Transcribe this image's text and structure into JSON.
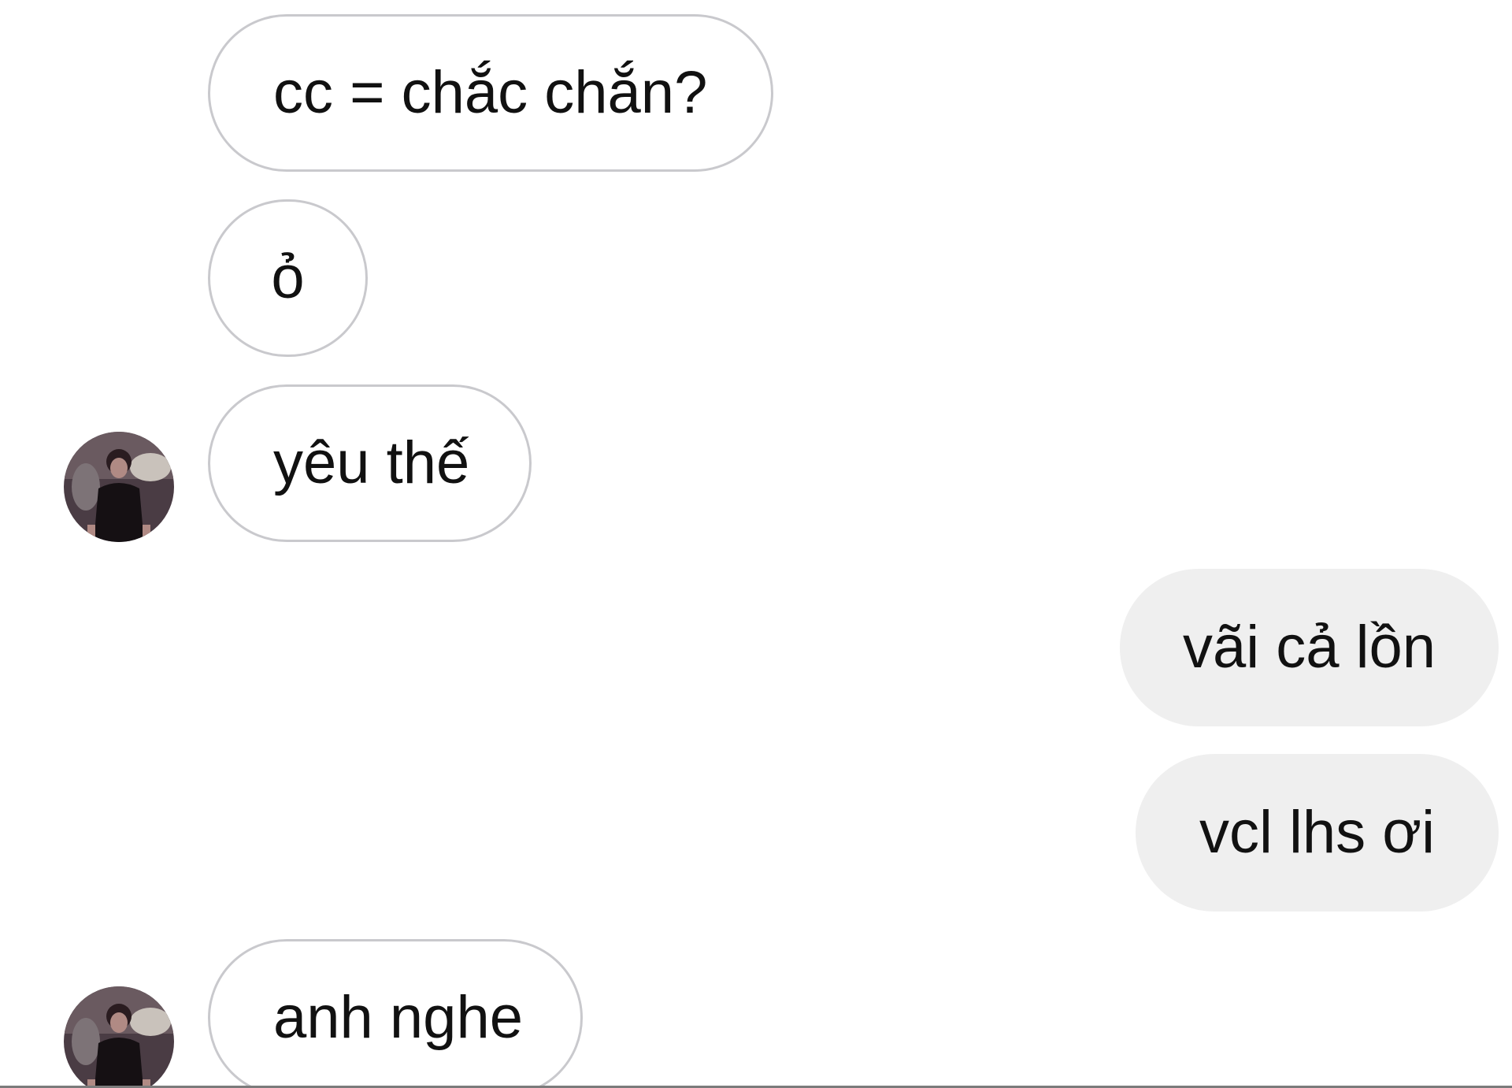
{
  "conversation": {
    "messages": [
      {
        "sender": "contact",
        "text": "cc = chắc chắn?"
      },
      {
        "sender": "contact",
        "text": "ỏ"
      },
      {
        "sender": "contact",
        "text": "yêu thế"
      },
      {
        "sender": "me",
        "text": "vãi cả lồn"
      },
      {
        "sender": "me",
        "text": "vcl lhs ơi"
      },
      {
        "sender": "contact",
        "text": "anh nghe"
      }
    ]
  },
  "colors": {
    "page_background": "#ffffff",
    "incoming_border": "#c9c9cd",
    "outgoing_background": "#efefef",
    "text": "#111111"
  },
  "icons": {
    "contact_avatar": "profile-photo-avatar"
  }
}
